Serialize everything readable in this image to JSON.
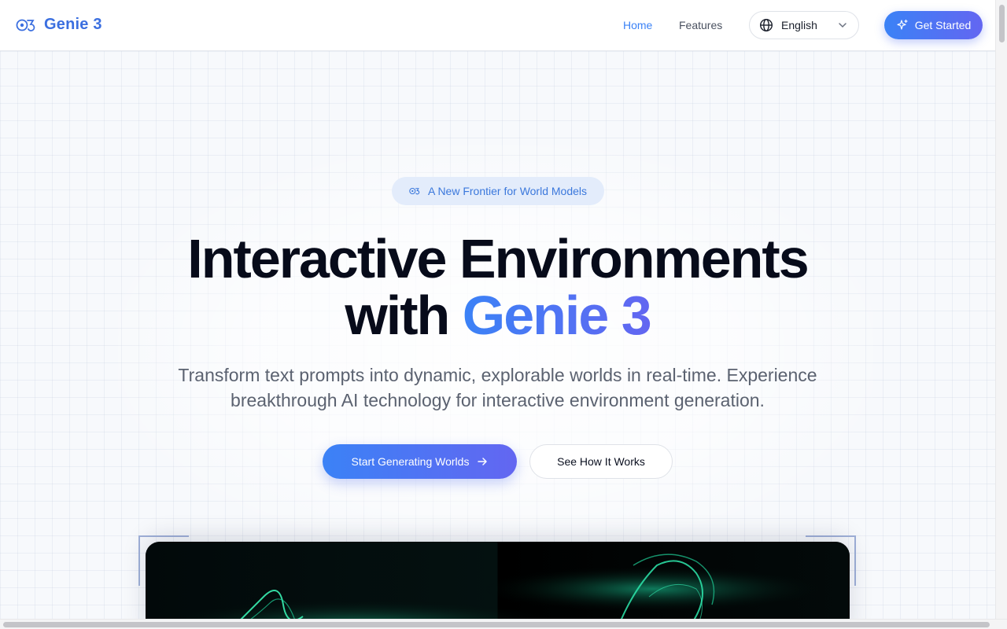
{
  "brand": {
    "name": "Genie 3",
    "logo_icon": "genie-logo-icon"
  },
  "nav": {
    "home": "Home",
    "features": "Features",
    "language": "English",
    "get_started": "Get Started"
  },
  "hero": {
    "badge": "A New Frontier for World Models",
    "headline_line1": "Interactive Environments",
    "headline_line2_plain": "with ",
    "headline_line2_accent": "Genie 3",
    "subtitle": "Transform text prompts into dynamic, explorable worlds in real-time. Experience breakthrough AI technology for interactive environment generation.",
    "primary_cta": "Start Generating Worlds",
    "secondary_cta": "See How It Works"
  },
  "colors": {
    "accent": "#3b82f6",
    "accent_end": "#6366f1",
    "headline": "#070b1a",
    "nav_active": "#3b82f6"
  }
}
